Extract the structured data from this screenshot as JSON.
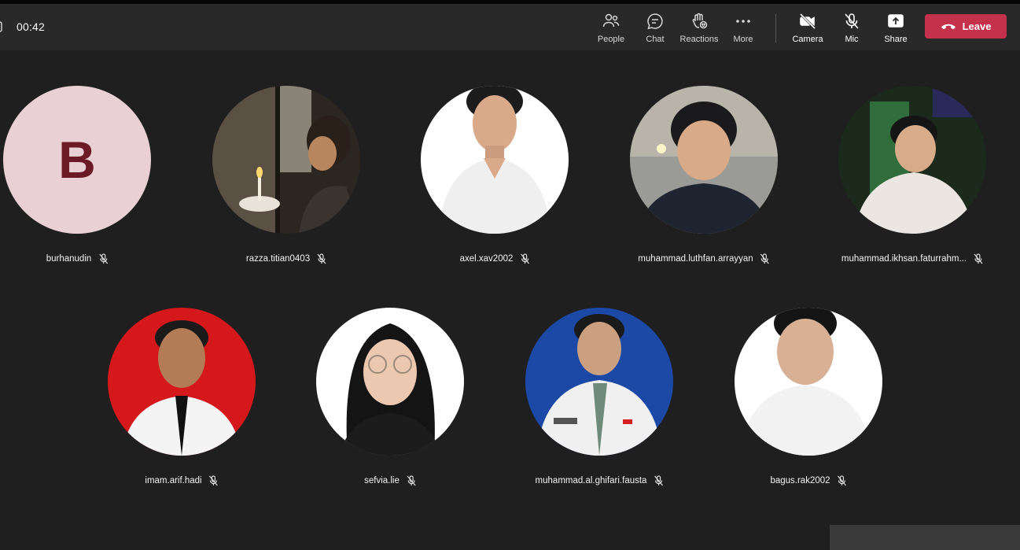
{
  "meeting": {
    "timer": "00:42"
  },
  "toolbar": {
    "people": "People",
    "chat": "Chat",
    "reactions": "Reactions",
    "more": "More",
    "camera": "Camera",
    "mic": "Mic",
    "share": "Share",
    "leave": "Leave"
  },
  "colors": {
    "leave": "#c4314b",
    "toolbar": "#292929",
    "stage": "#1f1f1f",
    "avatar_initial_bg": "#e8d0d4",
    "avatar_initial_fg": "#6b1a26"
  },
  "participants": [
    {
      "name": "burhanudin",
      "initial": "B",
      "muted": true
    },
    {
      "name": "razza.titian0403",
      "muted": true
    },
    {
      "name": "axel.xav2002",
      "muted": true
    },
    {
      "name": "muhammad.luthfan.arrayyan",
      "muted": true
    },
    {
      "name": "muhammad.ikhsan.faturrahm...",
      "muted": true
    },
    {
      "name": "imam.arif.hadi",
      "muted": true
    },
    {
      "name": "sefvia.lie",
      "muted": true
    },
    {
      "name": "muhammad.al.ghifari.fausta",
      "muted": true
    },
    {
      "name": "bagus.rak2002",
      "muted": true
    }
  ]
}
